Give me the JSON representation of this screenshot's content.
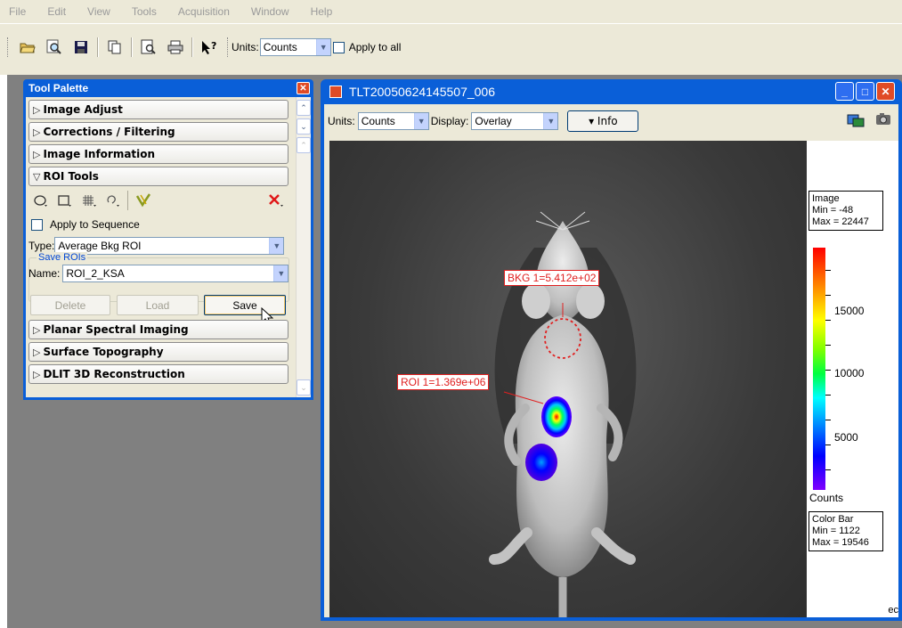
{
  "menu": [
    "File",
    "Edit",
    "View",
    "Tools",
    "Acquisition",
    "Window",
    "Help"
  ],
  "toolbar": {
    "icons": [
      "open-folder-icon",
      "search-icon",
      "save-icon",
      "copy-icon",
      "print-preview-icon",
      "print-icon",
      "whats-this-help-icon"
    ],
    "units_label": "Units:",
    "units_value": "Counts",
    "apply_all_label": "Apply to all"
  },
  "palette": {
    "title": "Tool Palette",
    "sections": [
      "Image Adjust",
      "Corrections / Filtering",
      "Image Information",
      "ROI Tools",
      "Planar Spectral Imaging",
      "Surface Topography",
      "DLIT 3D Reconstruction"
    ],
    "apply_sequence_label": "Apply to Sequence",
    "type_label": "Type:",
    "type_value": "Average Bkg ROI",
    "save_rois_label": "Save ROIs",
    "name_label": "Name:",
    "name_value": "ROI_2_KSA",
    "delete_label": "Delete",
    "load_label": "Load",
    "save_label": "Save"
  },
  "image_window": {
    "title": "TLT20050624145507_006",
    "units_label": "Units:",
    "units_value": "Counts",
    "display_label": "Display:",
    "display_value": "Overlay",
    "info_label": "▾ Info",
    "bkg_label": "BKG 1=5.412e+02",
    "roi_label": "ROI 1=1.369e+06",
    "image_box": [
      "Image",
      "Min = -48",
      "Max = 22447"
    ],
    "tick_labels": [
      "15000",
      "10000",
      "5000"
    ],
    "counts_label": "Counts",
    "colorbar_box": [
      "Color Bar",
      "Min = 1122",
      "Max = 19546"
    ],
    "corner_text": "ec"
  },
  "colors": {
    "titlebar": "#0a5fd8",
    "roi_red": "#e02020",
    "face": "#ece9d8",
    "workspace": "#808080"
  }
}
